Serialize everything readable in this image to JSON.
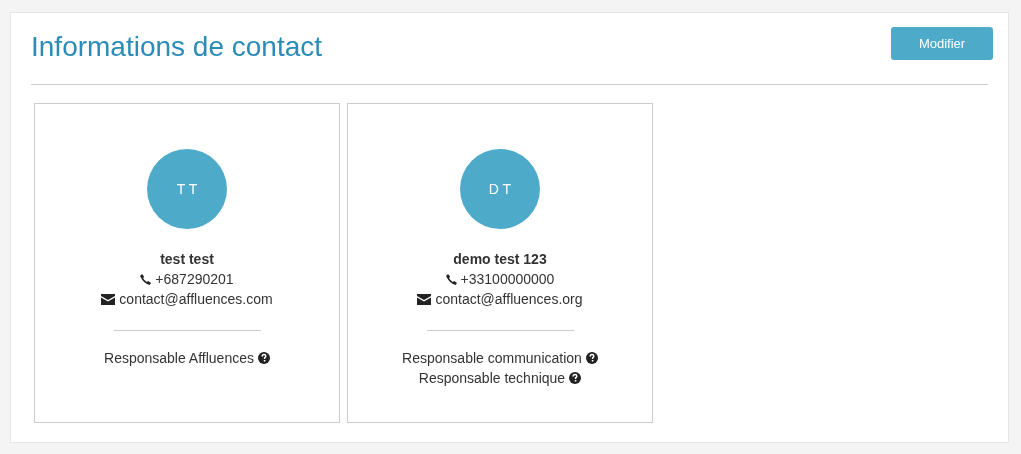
{
  "header": {
    "title": "Informations de contact",
    "button": "Modifier"
  },
  "contacts": [
    {
      "initials": "T T",
      "name": "test test",
      "phone": "+687290201",
      "email": "contact@affluences.com",
      "roles": [
        "Responsable Affluences"
      ]
    },
    {
      "initials": "D T",
      "name": "demo test 123",
      "phone": "+33100000000",
      "email": "contact@affluences.org",
      "roles": [
        "Responsable communication",
        "Responsable technique"
      ]
    }
  ]
}
